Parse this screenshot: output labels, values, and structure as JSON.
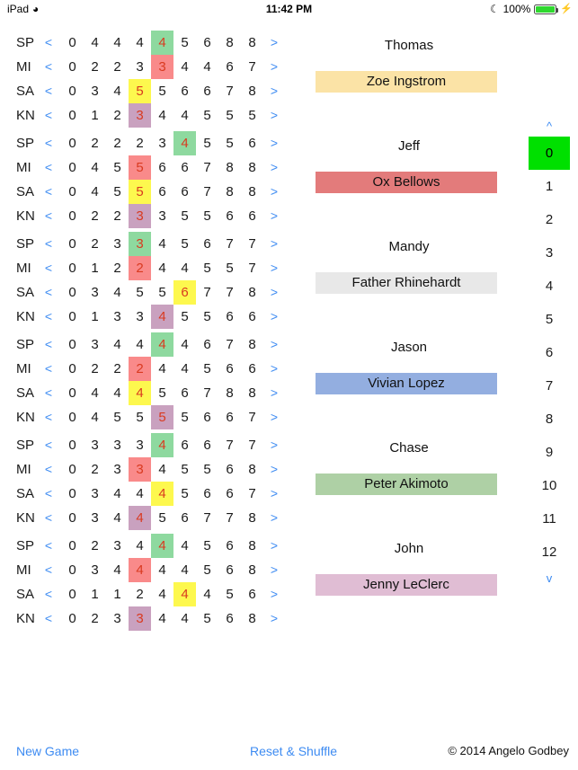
{
  "status_bar": {
    "device": "iPad",
    "wifi_icon": "wifi-icon",
    "time": "11:42 PM",
    "dnd_icon": "moon-icon",
    "battery_percent": "100%",
    "charging_icon": "bolt-icon"
  },
  "grid": {
    "row_labels": [
      "SP",
      "MI",
      "SA",
      "KN"
    ],
    "prev_label": "<",
    "next_label": ">",
    "highlight_colors": {
      "SP": "#8ed99f",
      "MI": "#f98a8a",
      "SA": "#fdf84e",
      "KN": "#c9a1bf"
    },
    "highlight_text_color": "#d93a20"
  },
  "players": [
    {
      "name": "Thomas",
      "caddy": "Zoe Ingstrom",
      "caddy_color": "#fbe3a6",
      "rows": [
        {
          "label": "SP",
          "values": [
            0,
            4,
            4,
            4,
            4,
            5,
            6,
            8,
            8
          ],
          "highlight_index": 4,
          "hl_class": "hl-green"
        },
        {
          "label": "MI",
          "values": [
            0,
            2,
            2,
            3,
            3,
            4,
            4,
            6,
            7
          ],
          "highlight_index": 4,
          "hl_class": "hl-red"
        },
        {
          "label": "SA",
          "values": [
            0,
            3,
            4,
            5,
            5,
            6,
            6,
            7,
            8
          ],
          "highlight_index": 3,
          "hl_class": "hl-yellow"
        },
        {
          "label": "KN",
          "values": [
            0,
            1,
            2,
            3,
            4,
            4,
            5,
            5,
            5
          ],
          "highlight_index": 3,
          "hl_class": "hl-purple"
        }
      ]
    },
    {
      "name": "Jeff",
      "caddy": "Ox Bellows",
      "caddy_color": "#e37b7b",
      "rows": [
        {
          "label": "SP",
          "values": [
            0,
            2,
            2,
            2,
            3,
            4,
            5,
            5,
            6
          ],
          "highlight_index": 5,
          "hl_class": "hl-green"
        },
        {
          "label": "MI",
          "values": [
            0,
            4,
            5,
            5,
            6,
            6,
            7,
            8,
            8
          ],
          "highlight_index": 3,
          "hl_class": "hl-red"
        },
        {
          "label": "SA",
          "values": [
            0,
            4,
            5,
            5,
            6,
            6,
            7,
            8,
            8
          ],
          "highlight_index": 3,
          "hl_class": "hl-yellow"
        },
        {
          "label": "KN",
          "values": [
            0,
            2,
            2,
            3,
            3,
            5,
            5,
            6,
            6
          ],
          "highlight_index": 3,
          "hl_class": "hl-purple"
        }
      ]
    },
    {
      "name": "Mandy",
      "caddy": "Father Rhinehardt",
      "caddy_color": "#e8e8e8",
      "rows": [
        {
          "label": "SP",
          "values": [
            0,
            2,
            3,
            3,
            4,
            5,
            6,
            7,
            7
          ],
          "highlight_index": 3,
          "hl_class": "hl-green"
        },
        {
          "label": "MI",
          "values": [
            0,
            1,
            2,
            2,
            4,
            4,
            5,
            5,
            7
          ],
          "highlight_index": 3,
          "hl_class": "hl-red"
        },
        {
          "label": "SA",
          "values": [
            0,
            3,
            4,
            5,
            5,
            6,
            7,
            7,
            8
          ],
          "highlight_index": 5,
          "hl_class": "hl-yellow"
        },
        {
          "label": "KN",
          "values": [
            0,
            1,
            3,
            3,
            4,
            5,
            5,
            6,
            6
          ],
          "highlight_index": 4,
          "hl_class": "hl-purple"
        }
      ]
    },
    {
      "name": "Jason",
      "caddy": "Vivian Lopez",
      "caddy_color": "#93aee0",
      "rows": [
        {
          "label": "SP",
          "values": [
            0,
            3,
            4,
            4,
            4,
            4,
            6,
            7,
            8
          ],
          "highlight_index": 4,
          "hl_class": "hl-green"
        },
        {
          "label": "MI",
          "values": [
            0,
            2,
            2,
            2,
            4,
            4,
            5,
            6,
            6
          ],
          "highlight_index": 3,
          "hl_class": "hl-red"
        },
        {
          "label": "SA",
          "values": [
            0,
            4,
            4,
            4,
            5,
            6,
            7,
            8,
            8
          ],
          "highlight_index": 3,
          "hl_class": "hl-yellow"
        },
        {
          "label": "KN",
          "values": [
            0,
            4,
            5,
            5,
            5,
            5,
            6,
            6,
            7
          ],
          "highlight_index": 4,
          "hl_class": "hl-purple"
        }
      ]
    },
    {
      "name": "Chase",
      "caddy": "Peter Akimoto",
      "caddy_color": "#aed0a5",
      "rows": [
        {
          "label": "SP",
          "values": [
            0,
            3,
            3,
            3,
            4,
            6,
            6,
            7,
            7
          ],
          "highlight_index": 4,
          "hl_class": "hl-green"
        },
        {
          "label": "MI",
          "values": [
            0,
            2,
            3,
            3,
            4,
            5,
            5,
            6,
            8
          ],
          "highlight_index": 3,
          "hl_class": "hl-red"
        },
        {
          "label": "SA",
          "values": [
            0,
            3,
            4,
            4,
            4,
            5,
            6,
            6,
            7
          ],
          "highlight_index": 4,
          "hl_class": "hl-yellow"
        },
        {
          "label": "KN",
          "values": [
            0,
            3,
            4,
            4,
            5,
            6,
            7,
            7,
            8
          ],
          "highlight_index": 3,
          "hl_class": "hl-purple"
        }
      ]
    },
    {
      "name": "John",
      "caddy": "Jenny LeClerc",
      "caddy_color": "#e0bdd4",
      "rows": [
        {
          "label": "SP",
          "values": [
            0,
            2,
            3,
            4,
            4,
            4,
            5,
            6,
            8
          ],
          "highlight_index": 4,
          "hl_class": "hl-green"
        },
        {
          "label": "MI",
          "values": [
            0,
            3,
            4,
            4,
            4,
            4,
            5,
            6,
            8
          ],
          "highlight_index": 3,
          "hl_class": "hl-red"
        },
        {
          "label": "SA",
          "values": [
            0,
            1,
            1,
            2,
            4,
            4,
            4,
            5,
            6
          ],
          "highlight_index": 5,
          "hl_class": "hl-yellow"
        },
        {
          "label": "KN",
          "values": [
            0,
            2,
            3,
            3,
            4,
            4,
            5,
            6,
            8
          ],
          "highlight_index": 3,
          "hl_class": "hl-purple"
        }
      ]
    }
  ],
  "number_strip": {
    "up_chevron": "^",
    "down_chevron": "v",
    "numbers": [
      "0",
      "1",
      "2",
      "3",
      "4",
      "5",
      "6",
      "7",
      "8",
      "9",
      "10",
      "11",
      "12"
    ],
    "selected": "0",
    "selected_color": "#00e000"
  },
  "footer": {
    "new_game": "New Game",
    "reset_shuffle": "Reset & Shuffle",
    "copyright": "© 2014 Angelo Godbey"
  }
}
